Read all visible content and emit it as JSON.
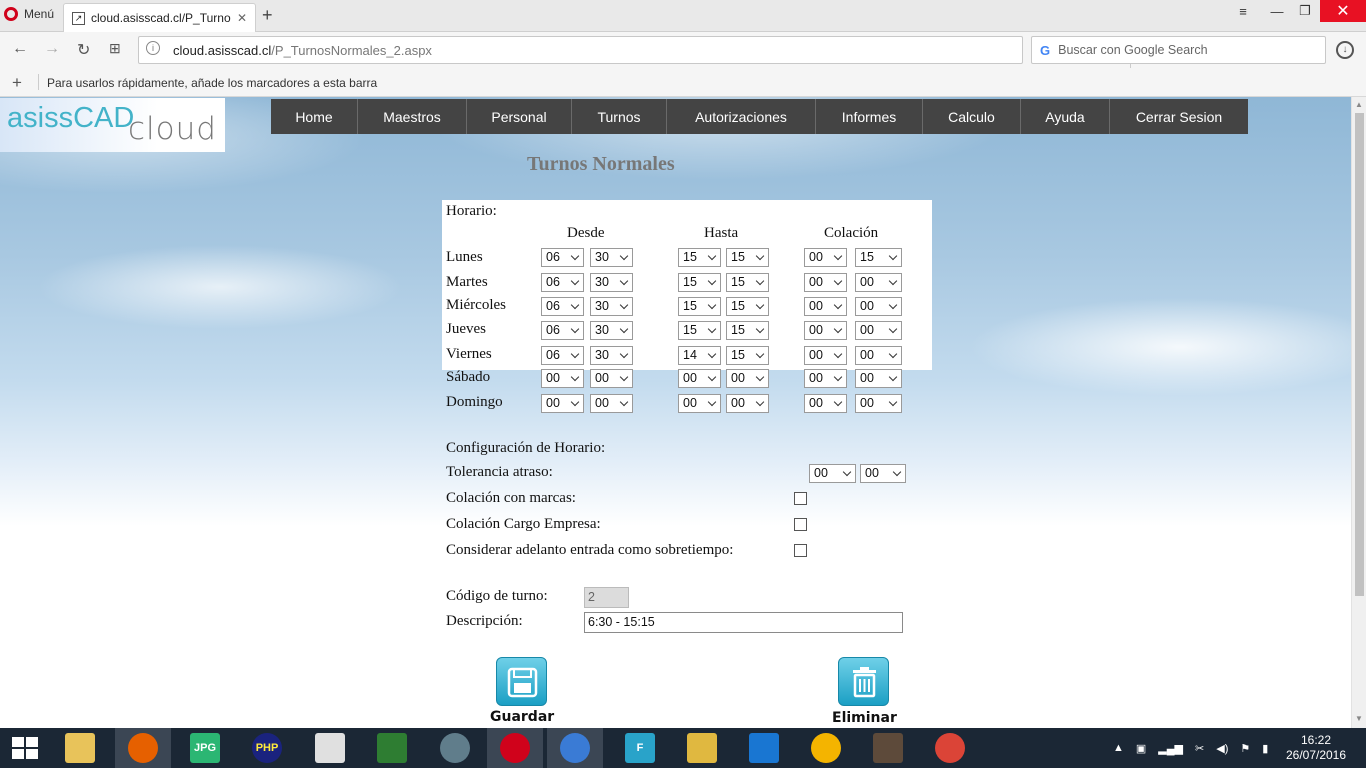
{
  "browser": {
    "menu_label": "Menú",
    "tab_title": "cloud.asisscad.cl/P_Turnos",
    "tab_close": "✕",
    "new_tab": "+",
    "url_host": "cloud.asisscad.cl",
    "url_path": "/P_TurnosNormales_2.aspx",
    "search_placeholder": "Buscar con Google Search",
    "bookmark_hint": "Para usarlos rápidamente, añade los marcadores a esta barra"
  },
  "logo": {
    "part1": "asissCAD",
    "part2": "cloud"
  },
  "nav": [
    "Home",
    "Maestros",
    "Personal",
    "Turnos",
    "Autorizaciones",
    "Informes",
    "Calculo",
    "Ayuda",
    "Cerrar Sesion"
  ],
  "page_title": "Turnos Normales",
  "schedule": {
    "section_label": "Horario:",
    "col_desde": "Desde",
    "col_hasta": "Hasta",
    "col_colacion": "Colación",
    "rows": [
      {
        "day": "Lunes",
        "desde_h": "06",
        "desde_m": "30",
        "hasta_h": "15",
        "hasta_m": "15",
        "col_h": "00",
        "col_m": "15"
      },
      {
        "day": "Martes",
        "desde_h": "06",
        "desde_m": "30",
        "hasta_h": "15",
        "hasta_m": "15",
        "col_h": "00",
        "col_m": "00"
      },
      {
        "day": "Miércoles",
        "desde_h": "06",
        "desde_m": "30",
        "hasta_h": "15",
        "hasta_m": "15",
        "col_h": "00",
        "col_m": "00"
      },
      {
        "day": "Jueves",
        "desde_h": "06",
        "desde_m": "30",
        "hasta_h": "15",
        "hasta_m": "15",
        "col_h": "00",
        "col_m": "00"
      },
      {
        "day": "Viernes",
        "desde_h": "06",
        "desde_m": "30",
        "hasta_h": "14",
        "hasta_m": "15",
        "col_h": "00",
        "col_m": "00"
      },
      {
        "day": "Sábado",
        "desde_h": "00",
        "desde_m": "00",
        "hasta_h": "00",
        "hasta_m": "00",
        "col_h": "00",
        "col_m": "00"
      },
      {
        "day": "Domingo",
        "desde_h": "00",
        "desde_m": "00",
        "hasta_h": "00",
        "hasta_m": "00",
        "col_h": "00",
        "col_m": "00"
      }
    ]
  },
  "config": {
    "section_label": "Configuración de Horario:",
    "tolerancia_label": "Tolerancia atraso:",
    "tolerancia_h": "00",
    "tolerancia_m": "00",
    "colacion_marcas_label": "Colación con marcas:",
    "colacion_empresa_label": "Colación Cargo Empresa:",
    "adelanto_label": "Considerar adelanto entrada como sobretiempo:"
  },
  "form": {
    "codigo_label": "Código de turno:",
    "codigo_value": "2",
    "descripcion_label": "Descripción:",
    "descripcion_value": "6:30 - 15:15"
  },
  "actions": {
    "save_label": "Guardar",
    "delete_label": "Eliminar"
  },
  "taskbar": {
    "time": "16:22",
    "date": "26/07/2016"
  }
}
